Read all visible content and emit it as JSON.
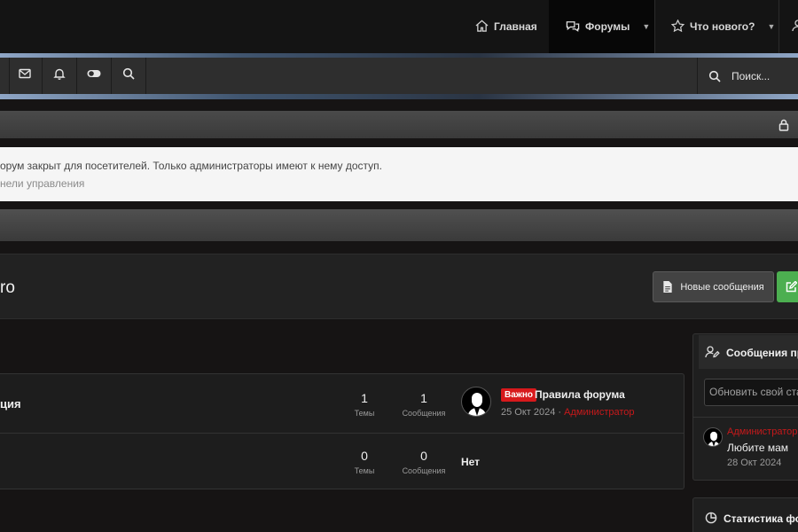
{
  "nav": {
    "home": "Главная",
    "forums": "Форумы",
    "whats_new": "Что нового?"
  },
  "toolbar": {
    "search_label": "Поиск..."
  },
  "notice": {
    "line1": "орум закрыт для посетителей. Только администраторы имеют к нему доступ.",
    "line2": "нели управления"
  },
  "page": {
    "title": "ro",
    "new_posts_button": "Новые сообщения"
  },
  "forums": [
    {
      "name": "ция",
      "threads": "1",
      "threads_label": "Темы",
      "messages": "1",
      "messages_label": "Сообщения",
      "last_badge": "Важно",
      "last_title": "Правила форума",
      "last_date": "25 Окт 2024",
      "last_sep": " · ",
      "last_author": "Администратор"
    },
    {
      "name": "",
      "threads": "0",
      "threads_label": "Темы",
      "messages": "0",
      "messages_label": "Сообщения",
      "last_none": "Нет"
    }
  ],
  "sidebar": {
    "profile_posts_title": "Сообщения пр",
    "status_placeholder": "Обновить свой ста",
    "post_author": "Администратор",
    "post_text": "Любите мам",
    "post_date": "28 Окт 2024",
    "stats_title": "Статистика фо"
  },
  "colors": {
    "accent_red": "#c7191b",
    "green_button": "#4caf50"
  }
}
